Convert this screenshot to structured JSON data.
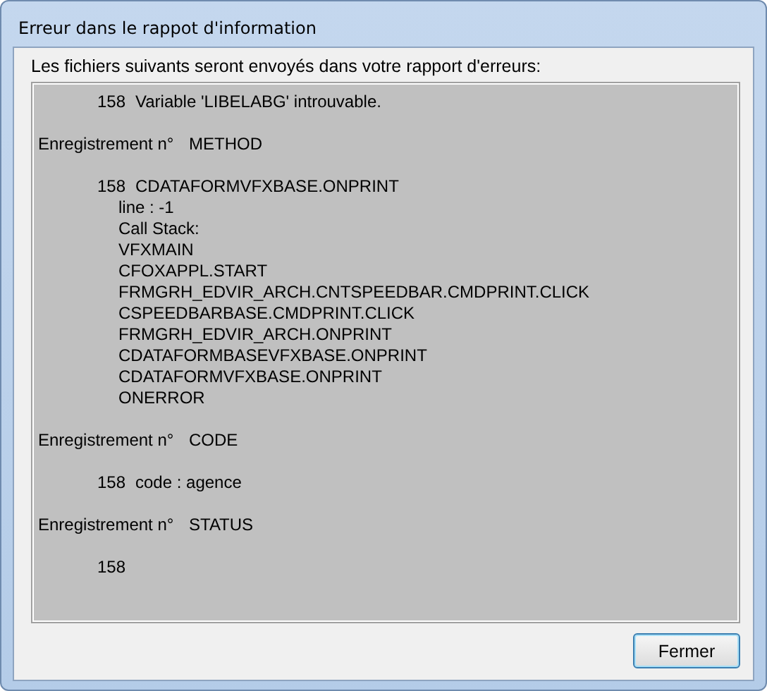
{
  "window": {
    "title": "Erreur dans le rappot d'information"
  },
  "intro": "Les fichiers suivants seront envoyés dans votre rapport d'erreurs:",
  "report": [
    {
      "kind": "entry",
      "number": "158",
      "text": "Variable 'LIBELABG' introuvable."
    },
    {
      "kind": "record",
      "label": "Enregistrement n°",
      "value": "METHOD"
    },
    {
      "kind": "entry",
      "number": "158",
      "text": "CDATAFORMVFXBASE.ONPRINT"
    },
    {
      "kind": "detail",
      "text": "line : -1"
    },
    {
      "kind": "detail",
      "text": "Call Stack:"
    },
    {
      "kind": "detail",
      "text": "VFXMAIN"
    },
    {
      "kind": "detail",
      "text": "CFOXAPPL.START"
    },
    {
      "kind": "detail",
      "text": "FRMGRH_EDVIR_ARCH.CNTSPEEDBAR.CMDPRINT.CLICK"
    },
    {
      "kind": "detail",
      "text": "CSPEEDBARBASE.CMDPRINT.CLICK"
    },
    {
      "kind": "detail",
      "text": "FRMGRH_EDVIR_ARCH.ONPRINT"
    },
    {
      "kind": "detail",
      "text": "CDATAFORMBASEVFXBASE.ONPRINT"
    },
    {
      "kind": "detail",
      "text": "CDATAFORMVFXBASE.ONPRINT"
    },
    {
      "kind": "detail",
      "text": "ONERROR"
    },
    {
      "kind": "record",
      "label": "Enregistrement n°",
      "value": "CODE"
    },
    {
      "kind": "entry",
      "number": "158",
      "text": "code : agence"
    },
    {
      "kind": "record",
      "label": "Enregistrement n°",
      "value": "STATUS"
    },
    {
      "kind": "entry",
      "number": "158"
    }
  ],
  "buttons": [
    "Fermer"
  ]
}
